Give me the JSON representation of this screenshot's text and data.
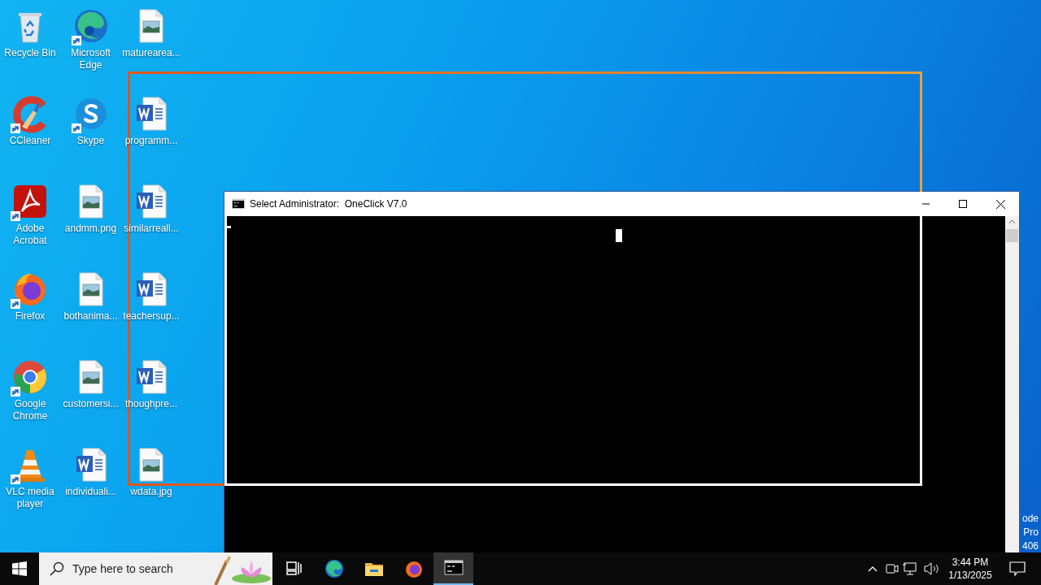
{
  "desktop_icons": [
    {
      "label": "Recycle Bin",
      "kind": "recycle",
      "shortcut": false
    },
    {
      "label": "CCleaner",
      "kind": "ccleaner",
      "shortcut": true
    },
    {
      "label": "Adobe Acrobat",
      "kind": "acrobat",
      "shortcut": true
    },
    {
      "label": "Firefox",
      "kind": "firefox",
      "shortcut": true
    },
    {
      "label": "Google Chrome",
      "kind": "chrome",
      "shortcut": true
    },
    {
      "label": "VLC media player",
      "kind": "vlc",
      "shortcut": true
    },
    {
      "label": "Microsoft Edge",
      "kind": "edge",
      "shortcut": true
    },
    {
      "label": "Skype",
      "kind": "skype",
      "shortcut": true
    },
    {
      "label": "andmm.png",
      "kind": "image",
      "shortcut": false
    },
    {
      "label": "bothanima...",
      "kind": "image",
      "shortcut": false
    },
    {
      "label": "customersi...",
      "kind": "image",
      "shortcut": false
    },
    {
      "label": "individuali...",
      "kind": "word",
      "shortcut": false
    },
    {
      "label": "maturearea...",
      "kind": "image",
      "shortcut": false
    },
    {
      "label": "programm...",
      "kind": "word",
      "shortcut": false
    },
    {
      "label": "similarreall...",
      "kind": "word",
      "shortcut": false
    },
    {
      "label": "teachersup...",
      "kind": "word",
      "shortcut": false
    },
    {
      "label": "thoughpre...",
      "kind": "word",
      "shortcut": false
    },
    {
      "label": "wdata.jpg",
      "kind": "image",
      "shortcut": false
    }
  ],
  "desktop_watermark": [
    "ode",
    "Pro",
    "406"
  ],
  "window": {
    "title": "Select Administrator:  OneClick V7.0"
  },
  "taskbar": {
    "search": {
      "placeholder": "Type here to search"
    },
    "apps": [
      {
        "kind": "taskview",
        "active": false
      },
      {
        "kind": "edge",
        "active": false
      },
      {
        "kind": "explorer",
        "active": false
      },
      {
        "kind": "firefox",
        "active": false
      },
      {
        "kind": "console",
        "active": true
      }
    ],
    "clock": {
      "time": "3:44 PM",
      "date": "1/13/2025"
    }
  }
}
